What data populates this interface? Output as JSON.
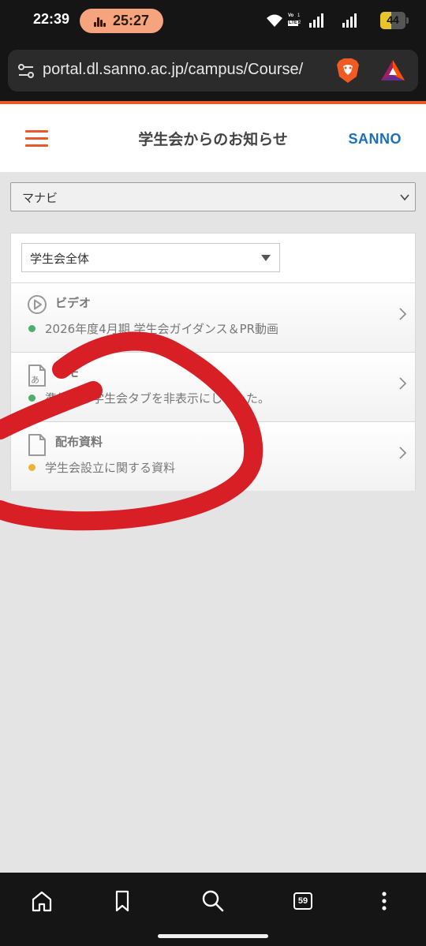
{
  "status_bar": {
    "time": "22:39",
    "timer": "25:27",
    "volte_line1": "Vo",
    "volte_line2": "LTE",
    "sim1": "1",
    "sim2": "2",
    "battery_level": "44"
  },
  "browser": {
    "url": "portal.dl.sanno.ac.jp/campus/Course/",
    "tab_count": "59"
  },
  "header": {
    "title": "学生会からのお知らせ",
    "logo": "SANNO"
  },
  "course_select": {
    "value": "マナビ"
  },
  "filter_select": {
    "value": "学生会全体"
  },
  "rows": [
    {
      "category": "ビデオ",
      "item": "2026年度4月期 学生会ガイダンス＆PR動画",
      "dot_color": "#4caf6a",
      "icon": "play-icon"
    },
    {
      "category": "メモ",
      "item": "準備中の学生会タブを非表示にしました。",
      "dot_color": "#4caf6a",
      "icon": "memo-icon"
    },
    {
      "category": "配布資料",
      "item": "学生会設立に関する資料",
      "dot_color": "#e8b53a",
      "icon": "document-icon"
    }
  ],
  "colors": {
    "accent": "#e8582a",
    "brand_blue": "#1d6fb8",
    "annotation": "#d81f26"
  }
}
